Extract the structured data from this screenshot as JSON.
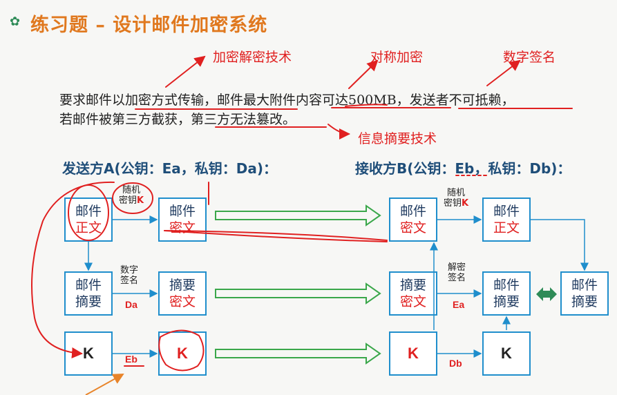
{
  "title": "练习题 – 设计邮件加密系统",
  "annotations": {
    "encryption_tech": "加密解密技术",
    "symmetric": "对称加密",
    "digital_signature": "数字签名",
    "digest_tech": "信息摘要技术"
  },
  "requirement": {
    "line1": "要求邮件以加密方式传输，邮件最大附件内容可达500MB，发送者不可抵赖，",
    "line2": "若邮件被第三方截获，第三方无法篡改。"
  },
  "sender": {
    "label": "发送方A(公钥：Ea，私钥：Da)："
  },
  "receiver": {
    "label": "接收方B(公钥：Eb，私钥：Db)："
  },
  "boxes": {
    "s_mail_body": {
      "l1": "邮件",
      "l2": "正文"
    },
    "s_mail_cipher": {
      "l1": "邮件",
      "l2": "密文"
    },
    "s_digest": {
      "l1": "邮件",
      "l2": "摘要"
    },
    "s_digest_cipher": {
      "l1": "摘要",
      "l2": "密文"
    },
    "s_k": {
      "k": "K"
    },
    "s_k_cipher": {
      "k": "K"
    },
    "r_mail_cipher": {
      "l1": "邮件",
      "l2": "密文"
    },
    "r_mail_body": {
      "l1": "邮件",
      "l2": "正文"
    },
    "r_digest_cipher": {
      "l1": "摘要",
      "l2": "密文"
    },
    "r_digest": {
      "l1": "邮件",
      "l2": "摘要"
    },
    "r_digest2": {
      "l1": "邮件",
      "l2": "摘要"
    },
    "r_k_cipher": {
      "k": "K"
    },
    "r_k": {
      "k": "K"
    }
  },
  "labels": {
    "random_key_l1": "随机",
    "random_key_l2": "密钥",
    "random_key_k": "K",
    "r_random_key_l1": "随机",
    "r_random_key_l2": "密钥",
    "r_random_key_k": "K",
    "digital_sig_l1": "数字",
    "digital_sig_l2": "签名",
    "da": "Da",
    "decrypt_sig_l1": "解密",
    "decrypt_sig_l2": "签名",
    "ea": "Ea",
    "eb": "Eb",
    "db": "Db"
  },
  "colors": {
    "title": "#e0781e",
    "annotation": "#e02020",
    "party_label": "#1f4e79",
    "box_border": "#1f8ecc",
    "flow_arrow": "#3aa74a"
  }
}
